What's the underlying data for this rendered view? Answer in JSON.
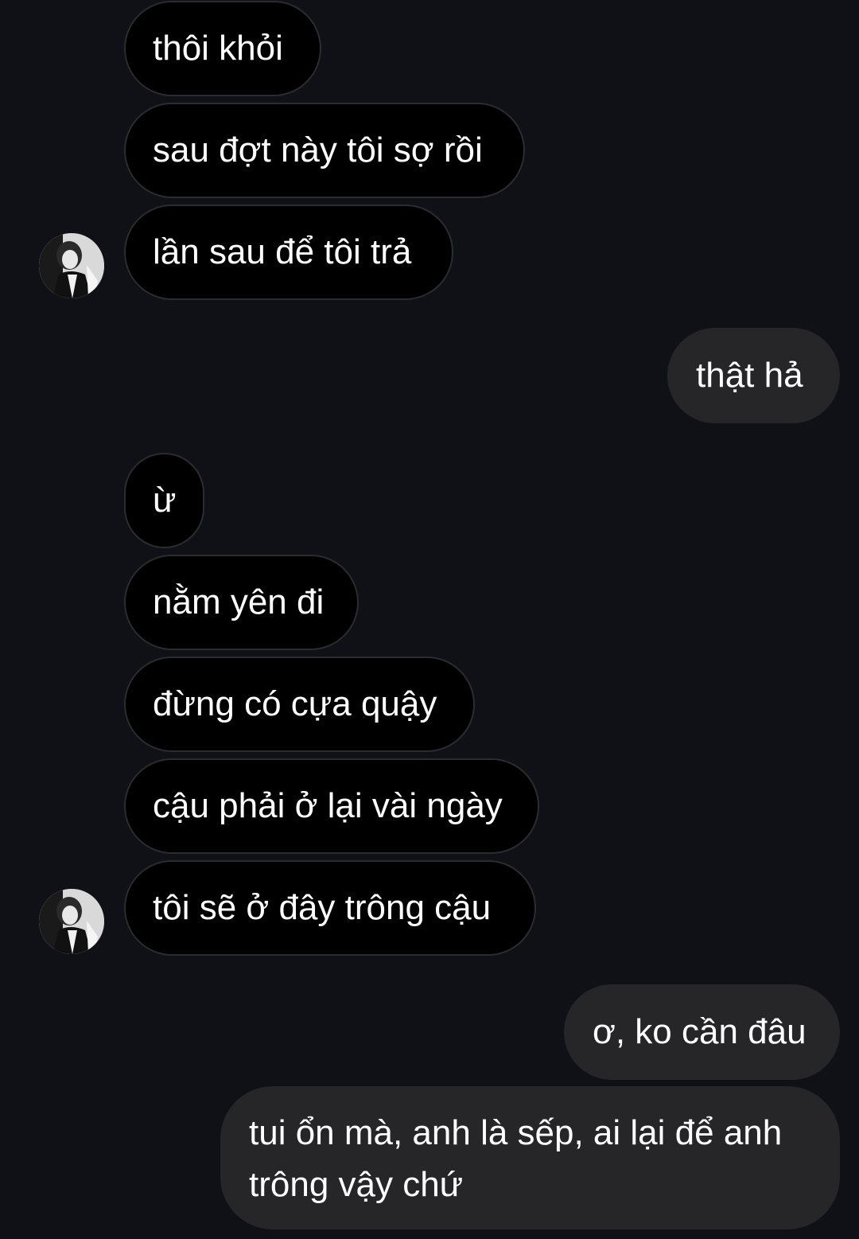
{
  "conversation": {
    "incoming": [
      "thôi khỏi",
      "sau đợt này tôi sợ rồi",
      "lần sau để tôi trả",
      "ừ",
      "nằm yên đi",
      "đừng có cựa quậy",
      "cậu phải ở lại vài ngày",
      "tôi sẽ ở đây trông cậu"
    ],
    "outgoing": [
      "thật hả",
      "ơ, ko cần đâu",
      "tui ổn mà, anh là sếp, ai lại để anh trông vậy chứ"
    ]
  },
  "theme": {
    "background": "#0f1117",
    "incoming_bubble": "#000000",
    "incoming_border": "#2c2c30",
    "outgoing_bubble": "#262628",
    "text": "#ffffff"
  },
  "icons": {
    "avatar": "profile-avatar-icon"
  }
}
